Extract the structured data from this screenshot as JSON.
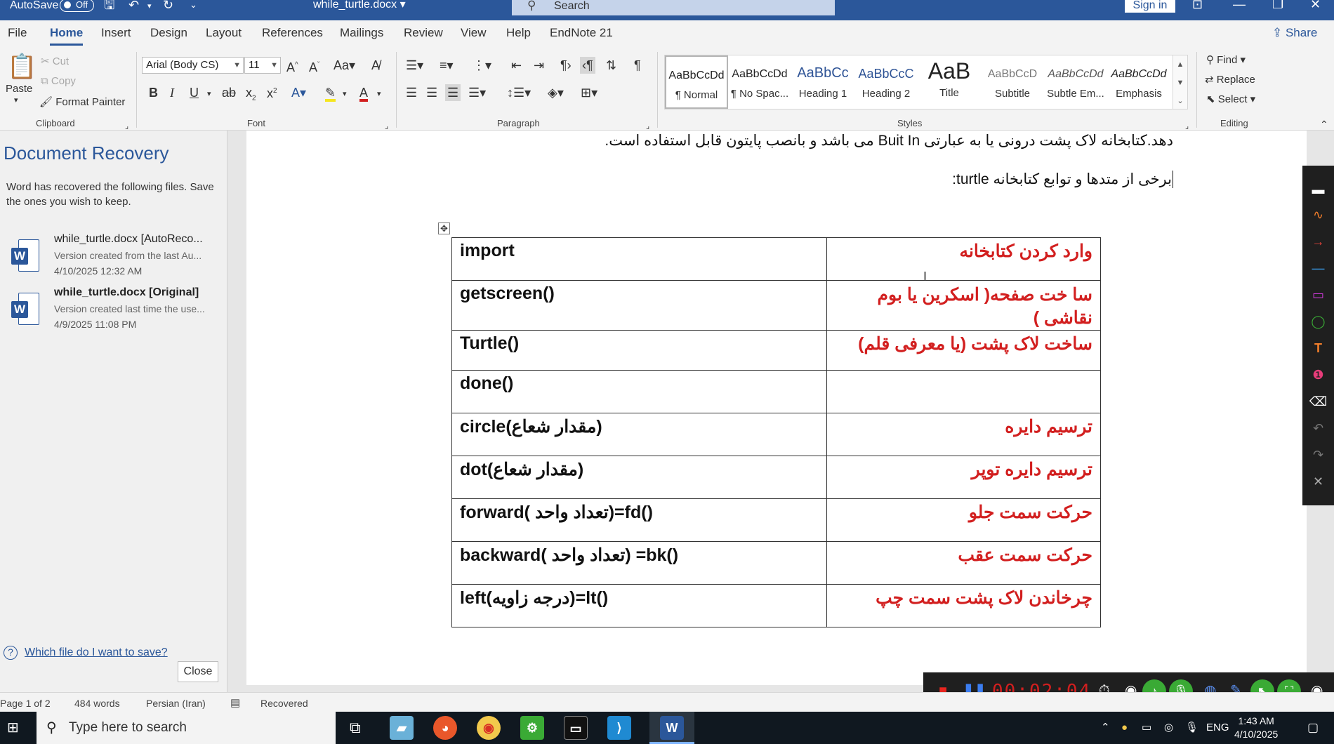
{
  "titlebar": {
    "autosave_label": "AutoSave",
    "autosave_state": "Off",
    "doc_title": "while_turtle.docx",
    "search_placeholder": "Search",
    "signin_label": "Sign in"
  },
  "tabs": [
    "File",
    "Home",
    "Insert",
    "Design",
    "Layout",
    "References",
    "Mailings",
    "Review",
    "View",
    "Help",
    "EndNote 21"
  ],
  "active_tab": "Home",
  "share_label": "Share",
  "ribbon": {
    "clipboard": {
      "paste": "Paste",
      "cut": "Cut",
      "copy": "Copy",
      "format_painter": "Format Painter",
      "label": "Clipboard"
    },
    "font": {
      "family": "Arial (Body CS)",
      "size": "11",
      "label": "Font"
    },
    "paragraph": {
      "label": "Paragraph"
    },
    "styles": {
      "label": "Styles",
      "items": [
        {
          "preview": "AaBbCcDd",
          "name": "¶ Normal"
        },
        {
          "preview": "AaBbCcDd",
          "name": "¶ No Spac..."
        },
        {
          "preview": "AaBbCc",
          "name": "Heading 1"
        },
        {
          "preview": "AaBbCcC",
          "name": "Heading 2"
        },
        {
          "preview": "AaB",
          "name": "Title"
        },
        {
          "preview": "AaBbCcD",
          "name": "Subtitle"
        },
        {
          "preview": "AaBbCcDd",
          "name": "Subtle Em..."
        },
        {
          "preview": "AaBbCcDd",
          "name": "Emphasis"
        }
      ]
    },
    "editing": {
      "find": "Find",
      "replace": "Replace",
      "select": "Select",
      "label": "Editing"
    }
  },
  "recovery": {
    "title": "Document Recovery",
    "description": "Word has recovered the following files. Save the ones you wish to keep.",
    "files": [
      {
        "name": "while_turtle.docx  [AutoReco...",
        "version": "Version created from the last Au...",
        "date": "4/10/2025 12:32 AM"
      },
      {
        "name": "while_turtle.docx  [Original]",
        "version": "Version created last time the use...",
        "date": "4/9/2025 11:08 PM"
      }
    ],
    "help_link": "Which file do I want to save?",
    "close_label": "Close"
  },
  "document": {
    "line1": "دهد.کتابخانه لاک پشت درونی یا به عبارتی Buit In می باشد و بانصب پایتون قابل استفاده است.",
    "line2": "برخی از متدها و توابع کتابخانه turtle:",
    "table": [
      {
        "en": "import",
        "fa": "وارد کردن کتابخانه"
      },
      {
        "en": "getscreen()",
        "fa": "سا خت صفحه( اسکرین یا بوم نقاشی )"
      },
      {
        "en": "Turtle()",
        "fa": "ساخت لاک پشت (یا معرفی قلم)"
      },
      {
        "en": "done()",
        "fa": ""
      },
      {
        "en": " circle(مقدار شعاع)",
        "fa": "ترسیم دایره"
      },
      {
        "en": "dot(مقدار شعاع)",
        "fa": "ترسیم دایره توپر"
      },
      {
        "en": " forward( تعداد واحد)=fd()",
        "fa": "حرکت سمت جلو"
      },
      {
        "en": " backward( تعداد واحد) =bk()",
        "fa": "حرکت سمت عقب"
      },
      {
        "en": " left(درجه زاویه)=lt()",
        "fa": "چرخاندن لاک پشت سمت چپ"
      }
    ]
  },
  "recorder": {
    "time": "00:02:04"
  },
  "statusbar": {
    "page": "Page 1 of 2",
    "words": "484 words",
    "language": "Persian (Iran)",
    "state": "Recovered"
  },
  "taskbar": {
    "search_placeholder": "Type here to search",
    "lang": "ENG",
    "time": "1:43 AM",
    "date": "4/10/2025"
  },
  "colors": {
    "word_blue": "#2b579a",
    "table_red": "#d21f1f",
    "recorder_bg": "#1f1f1f"
  }
}
